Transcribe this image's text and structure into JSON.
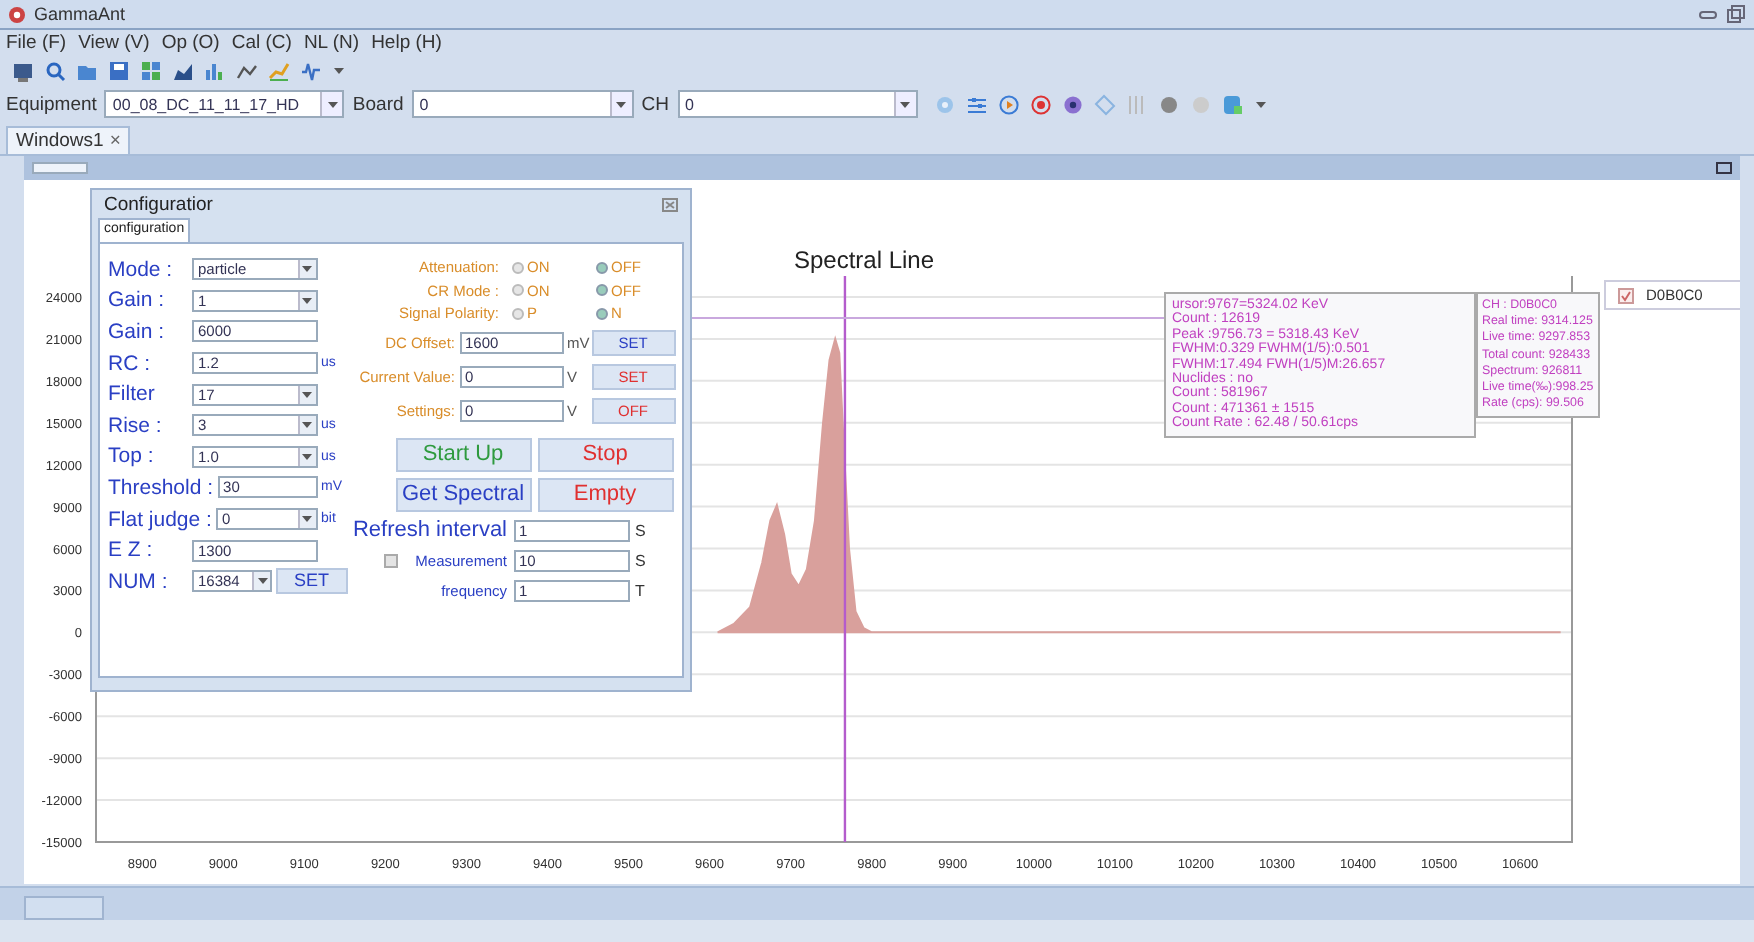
{
  "window": {
    "title": "GammaAnt"
  },
  "menu": [
    "File (F)",
    "View (V)",
    "Op (O)",
    "Cal (C)",
    "NL (N)",
    "Help (H)"
  ],
  "device_bar": [
    {
      "label": "Equipment",
      "value": "00_08_DC_11_11_17_HD"
    },
    {
      "label": "Board",
      "value": "0"
    },
    {
      "label": "CH",
      "value": "0"
    }
  ],
  "tabs": [
    {
      "label": "Windows1",
      "close": "×",
      "selected": true
    }
  ],
  "config": {
    "title": "Configuratior",
    "tab": "configuration",
    "fields": [
      {
        "label": "Mode :",
        "value": "particle",
        "kind": "select"
      },
      {
        "label": "Gain :",
        "value": "1",
        "kind": "select"
      },
      {
        "label": "Gain :",
        "value": "6000",
        "kind": "text"
      },
      {
        "label": "RC :",
        "value": "1.2",
        "kind": "text",
        "unit": "us"
      },
      {
        "label": "Filter",
        "value": "17",
        "kind": "select"
      },
      {
        "label": "Rise :",
        "value": "3",
        "kind": "select",
        "unit": "us"
      },
      {
        "label": "Top :",
        "value": "1.0",
        "kind": "select",
        "unit": "us"
      },
      {
        "label": "Threshold :",
        "value": "30",
        "kind": "text",
        "unit": "mV"
      },
      {
        "label": "Flat judge :",
        "value": "0",
        "kind": "select",
        "unit": "bit"
      },
      {
        "label": "E Z :",
        "value": "1300",
        "kind": "text"
      }
    ],
    "num": {
      "label": "NUM :",
      "value": "16384",
      "button": "SET"
    },
    "options": [
      {
        "label": "Attenuation:",
        "choices": [
          {
            "label": "ON",
            "selected": false
          },
          {
            "label": "OFF",
            "selected": true
          }
        ]
      },
      {
        "label": "CR Mode :",
        "choices": [
          {
            "label": "ON",
            "selected": false
          },
          {
            "label": "OFF",
            "selected": true
          }
        ]
      },
      {
        "label": "Signal Polarity:",
        "choices": [
          {
            "label": "P",
            "selected": false
          },
          {
            "label": "N",
            "selected": true
          }
        ]
      }
    ],
    "values": [
      {
        "label": "DC Offset:",
        "value": "1600",
        "unit": "mV",
        "button": "SET",
        "alert": false
      },
      {
        "label": "Current Value:",
        "value": "0",
        "unit": "V",
        "button": "SET",
        "alert": true
      },
      {
        "label": "Settings:",
        "value": "0",
        "unit": "V",
        "button": "OFF",
        "alert": true
      }
    ],
    "actions": [
      {
        "label": "Start Up",
        "kind": "start"
      },
      {
        "label": "Stop",
        "kind": "stop"
      },
      {
        "label": "Get Spectral",
        "kind": "get"
      },
      {
        "label": "Empty",
        "kind": "empty"
      }
    ],
    "timing": [
      {
        "label": "Refresh interval",
        "value": "1",
        "unit": "S",
        "kind": "plain"
      },
      {
        "label": "Measurement",
        "value": "10",
        "unit": "S",
        "kind": "checkbox",
        "checked": false
      },
      {
        "label": "frequency",
        "value": "1",
        "unit": "T",
        "kind": "plain"
      }
    ]
  },
  "chart": {
    "chart_data": {
      "type": "area",
      "title": "Spectral Line",
      "grid": true,
      "x": [
        9610,
        9630,
        9650,
        9665,
        9675,
        9683,
        9692,
        9700,
        9710,
        9720,
        9730,
        9740,
        9748,
        9755,
        9760,
        9765,
        9772,
        9780,
        9790,
        9800,
        10650
      ],
      "series": [
        {
          "name": "D0B0C0",
          "color": "#d9a09c",
          "values": [
            0,
            600,
            1800,
            5000,
            8000,
            9100,
            7000,
            4200,
            3300,
            4500,
            8000,
            15000,
            19500,
            21000,
            20000,
            14000,
            6000,
            1500,
            300,
            0,
            0
          ]
        }
      ],
      "xlim": [
        8843,
        10664
      ],
      "ylim": [
        -15000,
        25500
      ],
      "xticks": [
        8900,
        9000,
        9100,
        9200,
        9300,
        9400,
        9500,
        9600,
        9700,
        9800,
        9900,
        10000,
        10100,
        10200,
        10300,
        10400,
        10500,
        10600
      ],
      "yticks": [
        -15000,
        -12000,
        -9000,
        -6000,
        -3000,
        0,
        3000,
        6000,
        9000,
        12000,
        15000,
        18000,
        21000,
        24000
      ],
      "ref_lines": [
        {
          "axis": "x",
          "value": 9767
        },
        {
          "axis": "y",
          "value": 22500
        }
      ]
    }
  },
  "cursor_info": [
    "ursor:9767=5324.02 KeV",
    "Count : 12619",
    "Peak :9756.73 = 5318.43 KeV",
    "FWHM:0.329 FWHM(1/5):0.501",
    "FWHM:17.494 FWH(1/5)M:26.657",
    "Nuclides : no",
    "Count : 581967",
    "Count : 471361 ± 1515",
    "Count Rate : 62.48 / 50.61cps"
  ],
  "channel_info": [
    "CH : D0B0C0",
    "Real time: 9314.125",
    "Live time: 9297.853",
    "Total count: 928433",
    "Spectrum: 926811",
    "Live time(‰):998.25",
    "Rate (cps): 99.506"
  ],
  "legend": {
    "checked": true
  }
}
